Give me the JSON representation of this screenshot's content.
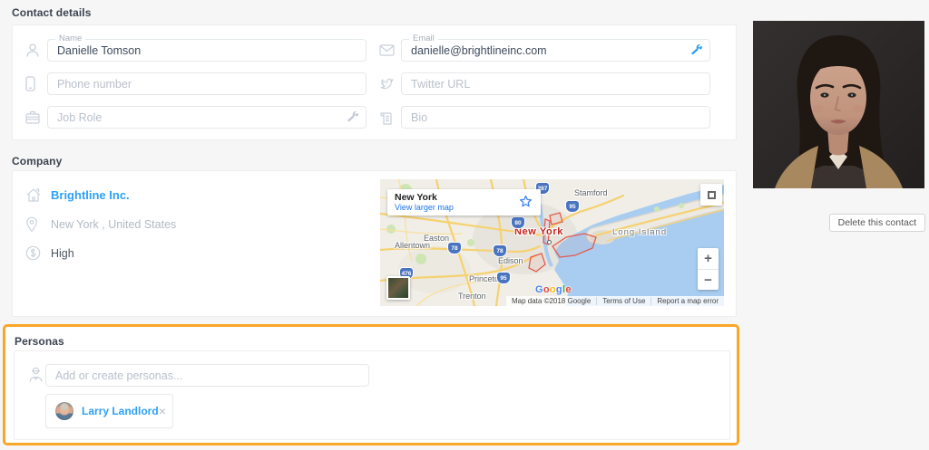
{
  "contact_details": {
    "title": "Contact details",
    "name": {
      "label": "Name",
      "value": "Danielle Tomson"
    },
    "email": {
      "label": "Email",
      "value": "danielle@brightlineinc.com"
    },
    "phone": {
      "placeholder": "Phone number"
    },
    "twitter": {
      "placeholder": "Twitter URL"
    },
    "job_role": {
      "placeholder": "Job Role"
    },
    "bio": {
      "placeholder": "Bio"
    }
  },
  "company": {
    "title": "Company",
    "name": "Brightline Inc.",
    "location": "New York , United States",
    "revenue": "High",
    "map": {
      "info_title": "New York",
      "info_link": "View larger map",
      "labels": {
        "stamford": "Stamford",
        "allentown": "Allentown",
        "easton": "Easton",
        "edison": "Edison",
        "princeton": "Princeton",
        "trenton": "Trenton",
        "long_island": "Long Island",
        "highlight": "New York"
      },
      "shields": {
        "i287": "287",
        "i95a": "95",
        "i80": "80",
        "i78a": "78",
        "i78b": "78",
        "i95b": "95",
        "i476": "476"
      },
      "logo_letters": [
        "G",
        "o",
        "o",
        "g",
        "l",
        "e"
      ],
      "attribution": "Map data ©2018 Google",
      "terms": "Terms of Use",
      "report": "Report a map error",
      "zoom_in": "+",
      "zoom_out": "−"
    }
  },
  "personas": {
    "title": "Personas",
    "input_placeholder": "Add or create personas...",
    "chip": {
      "name": "Larry Landlord",
      "remove": "×"
    }
  },
  "actions": {
    "delete_label": "Delete this contact"
  },
  "colors": {
    "accent_blue": "#2ea1f8",
    "highlight_orange": "#f9a629",
    "link_blue": "#1a73e8"
  }
}
